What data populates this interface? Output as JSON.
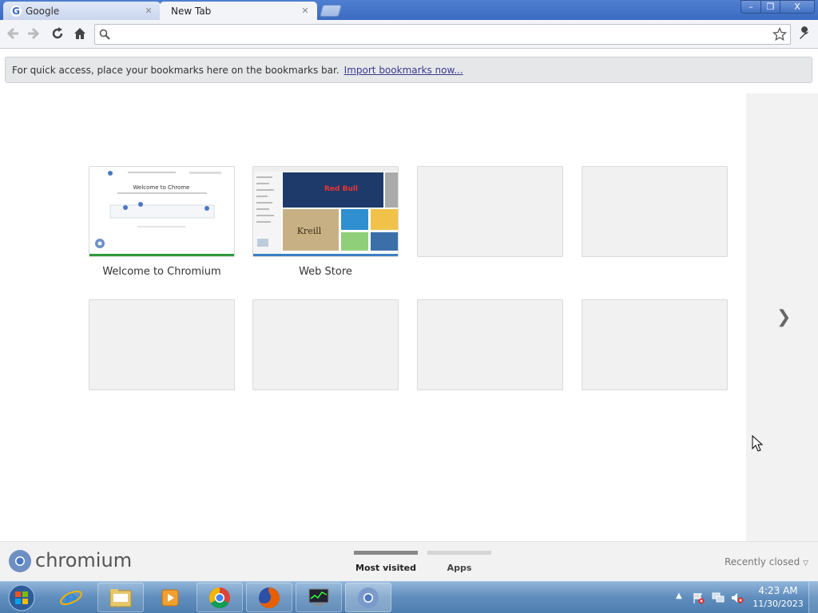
{
  "tabs": [
    {
      "title": "Google",
      "active": false
    },
    {
      "title": "New Tab",
      "active": true
    }
  ],
  "window_controls": {
    "minimize": "–",
    "maximize": "❐",
    "close": "X"
  },
  "omnibox": {
    "value": "",
    "placeholder": ""
  },
  "bookmark_bar": {
    "text": "For quick access, place your bookmarks here on the bookmarks bar.",
    "import_link": "Import bookmarks now..."
  },
  "thumbnails": [
    {
      "title": "Welcome to Chromium",
      "filled": true,
      "bar_color": "#2e9b3a"
    },
    {
      "title": "Web Store",
      "filled": true,
      "bar_color": "#3a7fc4"
    },
    {
      "title": "",
      "filled": false
    },
    {
      "title": "",
      "filled": false
    },
    {
      "title": "",
      "filled": false
    },
    {
      "title": "",
      "filled": false
    },
    {
      "title": "",
      "filled": false
    },
    {
      "title": "",
      "filled": false
    }
  ],
  "welcome_thumb": {
    "heading": "Welcome to Chrome"
  },
  "webstore_thumb": {
    "banner": "Red Bull",
    "tile": "Kreill"
  },
  "footer": {
    "brand": "chromium",
    "tabs": [
      {
        "label": "Most visited",
        "selected": true
      },
      {
        "label": "Apps",
        "selected": false
      }
    ],
    "recently_closed": "Recently closed"
  },
  "taskbar": {
    "items": [
      "internet-explorer",
      "file-explorer",
      "media-player",
      "chrome",
      "firefox",
      "system-monitor",
      "chromium"
    ],
    "time": "4:23 AM",
    "date": "11/30/2023"
  },
  "colors": {
    "accent": "#3b6bc1",
    "taskbar": "#5f8dbd"
  }
}
